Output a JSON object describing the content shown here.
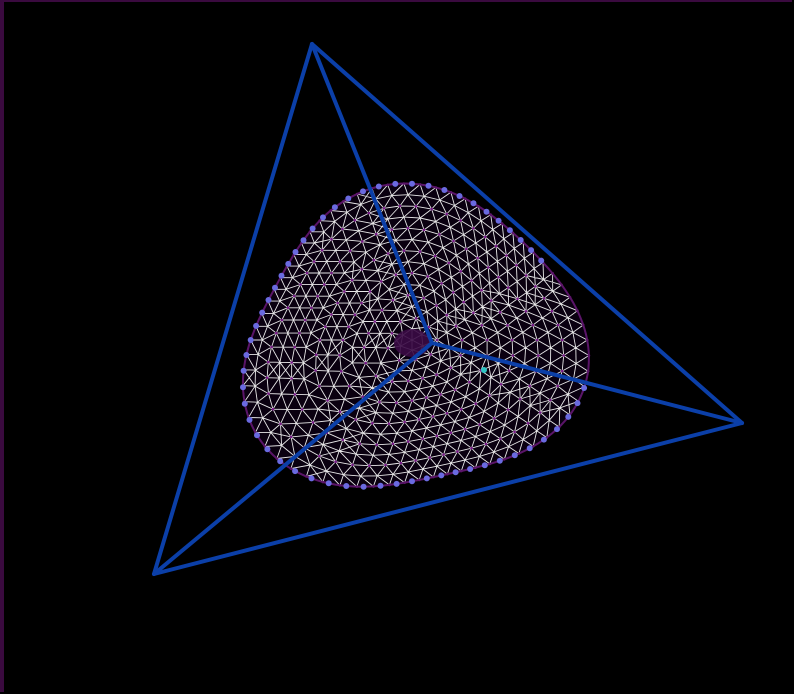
{
  "scene": {
    "background": "#000000",
    "frame_color": "#3a0a3f",
    "colors": {
      "tetrahedron_edges": "#0b3fa8",
      "mesh_lines": "#ffffff",
      "mesh_vertices": "#7a1a8a",
      "boundary_curve": "#5a1468",
      "boundary_nodes": "#6a6ae0",
      "center_hub": "#3a0a45",
      "marker_point": "#2ec4c4"
    },
    "visible_text": []
  }
}
